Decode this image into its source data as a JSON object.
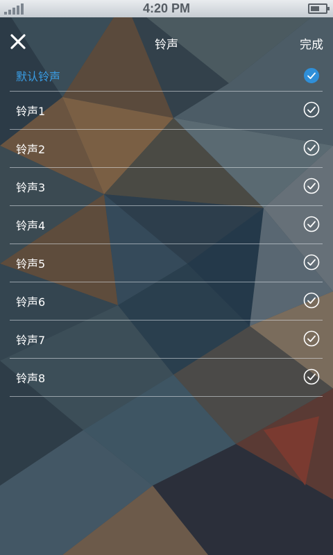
{
  "status_bar": {
    "time": "4:20 PM",
    "battery_icon": "battery-icon",
    "signal_icon": "signal-icon"
  },
  "header": {
    "close_icon": "close-icon",
    "title": "铃声",
    "done_label": "完成"
  },
  "ringtones": [
    {
      "label": "默认铃声",
      "selected": true
    },
    {
      "label": "铃声1",
      "selected": false
    },
    {
      "label": "铃声2",
      "selected": false
    },
    {
      "label": "铃声3",
      "selected": false
    },
    {
      "label": "铃声4",
      "selected": false
    },
    {
      "label": "铃声5",
      "selected": false
    },
    {
      "label": "铃声6",
      "selected": false
    },
    {
      "label": "铃声7",
      "selected": false
    },
    {
      "label": "铃声8",
      "selected": false
    }
  ],
  "colors": {
    "selected_text": "#3a9de4",
    "selected_check_fill": "#2f8fd8",
    "divider": "#e6ebf0"
  }
}
